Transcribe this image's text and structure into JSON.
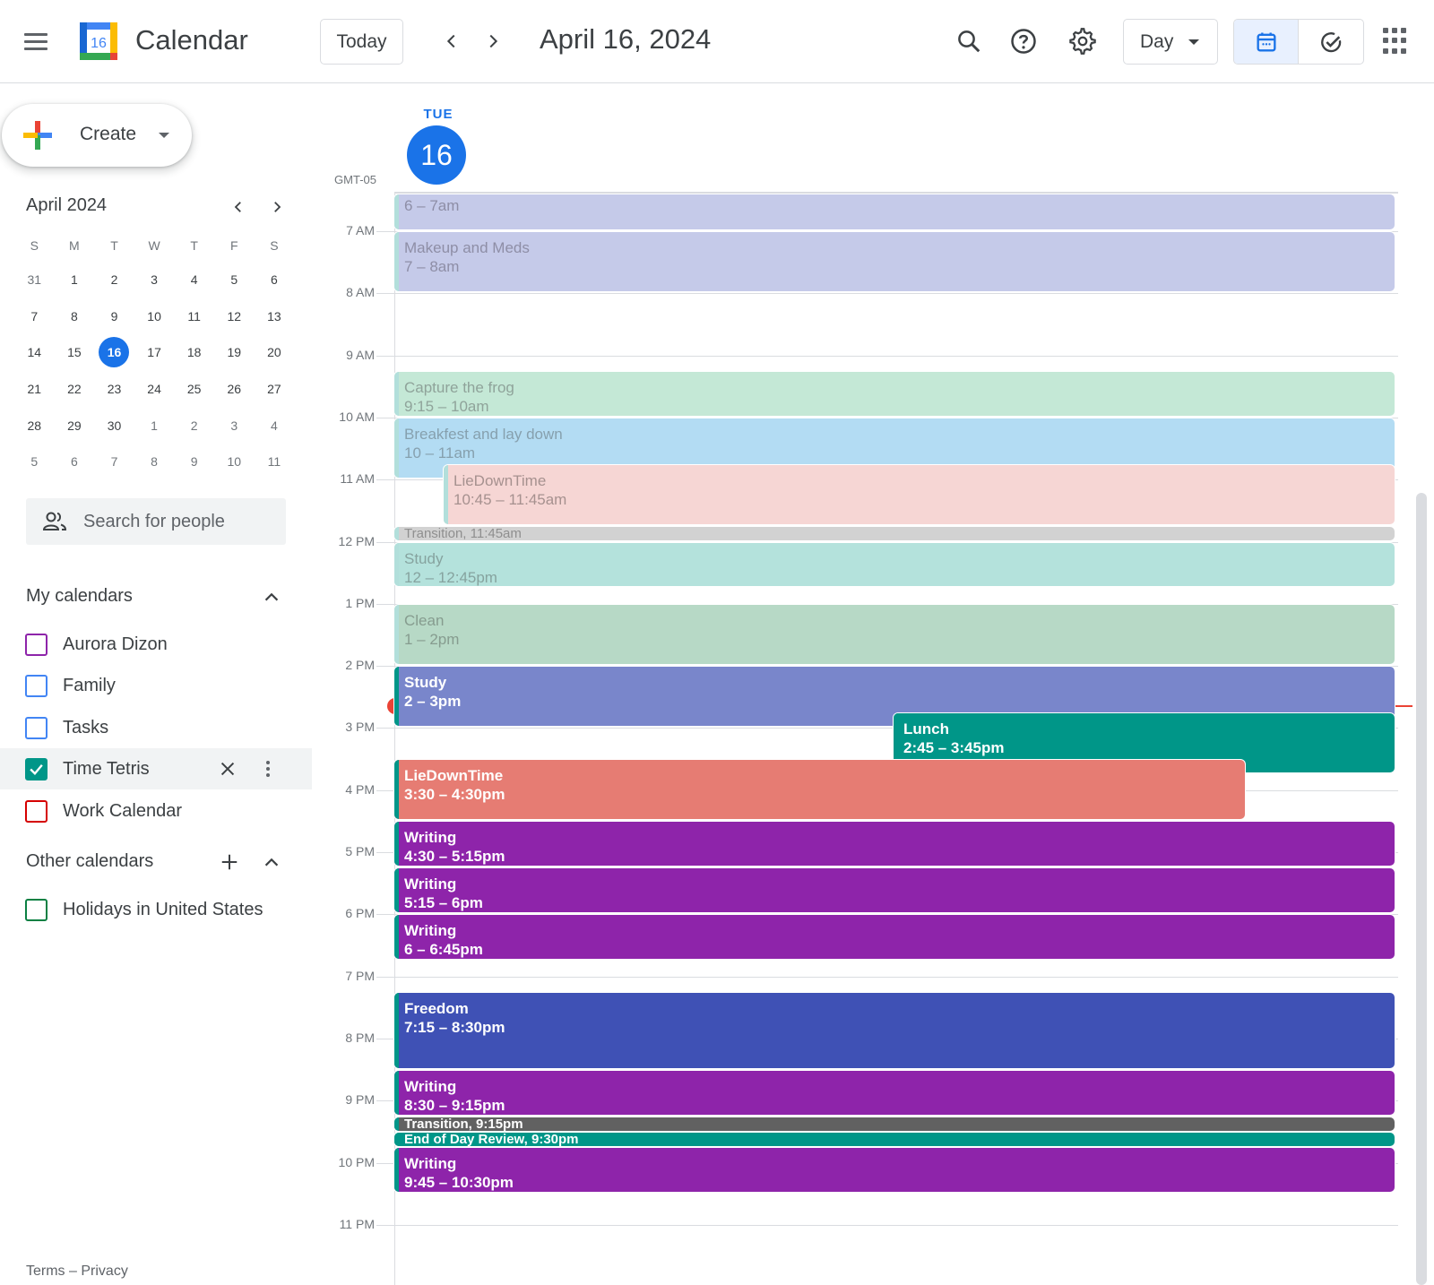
{
  "header": {
    "app_name": "Calendar",
    "logo_day": "16",
    "today_label": "Today",
    "date_title": "April 16, 2024",
    "view_label": "Day"
  },
  "sidebar": {
    "create_label": "Create",
    "mini_calendar": {
      "month_label": "April 2024",
      "weekdays": [
        "S",
        "M",
        "T",
        "W",
        "T",
        "F",
        "S"
      ],
      "weeks": [
        [
          "31",
          "1",
          "2",
          "3",
          "4",
          "5",
          "6"
        ],
        [
          "7",
          "8",
          "9",
          "10",
          "11",
          "12",
          "13"
        ],
        [
          "14",
          "15",
          "16",
          "17",
          "18",
          "19",
          "20"
        ],
        [
          "21",
          "22",
          "23",
          "24",
          "25",
          "26",
          "27"
        ],
        [
          "28",
          "29",
          "30",
          "1",
          "2",
          "3",
          "4"
        ],
        [
          "5",
          "6",
          "7",
          "8",
          "9",
          "10",
          "11"
        ]
      ],
      "selected": "16"
    },
    "search_placeholder": "Search for people",
    "my_calendars_title": "My calendars",
    "my_calendars": [
      {
        "label": "Aurora Dizon",
        "color": "#8e24aa",
        "checked": false
      },
      {
        "label": "Family",
        "color": "#4285f4",
        "checked": false
      },
      {
        "label": "Tasks",
        "color": "#4285f4",
        "checked": false
      },
      {
        "label": "Time Tetris",
        "color": "#009688",
        "checked": true
      },
      {
        "label": "Work Calendar",
        "color": "#d50000",
        "checked": false
      }
    ],
    "other_calendars_title": "Other calendars",
    "other_calendars": [
      {
        "label": "Holidays in United States",
        "color": "#0b8043",
        "checked": false
      }
    ],
    "footer": {
      "terms": "Terms",
      "sep": "–",
      "privacy": "Privacy"
    }
  },
  "day_view": {
    "weekday": "TUE",
    "day_number": "16",
    "timezone": "GMT-05",
    "hours": [
      "7 AM",
      "8 AM",
      "9 AM",
      "10 AM",
      "11 AM",
      "12 PM",
      "1 PM",
      "2 PM",
      "3 PM",
      "4 PM",
      "5 PM",
      "6 PM",
      "7 PM",
      "8 PM",
      "9 PM",
      "10 PM",
      "11 PM"
    ],
    "current_time": "2:40pm",
    "events": [
      {
        "title": "",
        "time": "6 – 7am",
        "color": "#c5cae9",
        "text_color": "#8e8ea6",
        "faded": true
      },
      {
        "title": "Makeup and Meds",
        "time": "7 – 8am",
        "color": "#c5cae9",
        "text_color": "#8e8ea6",
        "faded": true
      },
      {
        "title": "Capture the frog",
        "time": "9:15 – 10am",
        "color": "#c4e8d6",
        "text_color": "#8fa39a",
        "faded": true
      },
      {
        "title": "Breakfest and lay down",
        "time": "10 – 11am",
        "color": "#b3dcf3",
        "text_color": "#86a0ae",
        "faded": true
      },
      {
        "title": "LieDownTime",
        "time": "10:45 – 11:45am",
        "color": "#f6d6d4",
        "text_color": "#a6918f",
        "faded": true
      },
      {
        "title": "Transition, 11:45am",
        "time": "",
        "color": "#d2d2d2",
        "text_color": "#8f8f8f",
        "faded": true
      },
      {
        "title": "Study",
        "time": "12 – 12:45pm",
        "color": "#b4e2dc",
        "text_color": "#86a39f",
        "faded": true
      },
      {
        "title": "Clean",
        "time": "1 – 2pm",
        "color": "#b7d9c6",
        "text_color": "#869c8f",
        "faded": true
      },
      {
        "title": "Study",
        "time": "2 – 3pm",
        "color": "#7986cb",
        "text_color": "#ffffff",
        "faded": false
      },
      {
        "title": "Lunch",
        "time": "2:45 – 3:45pm",
        "color": "#009688",
        "text_color": "#ffffff",
        "faded": false
      },
      {
        "title": "LieDownTime",
        "time": "3:30 – 4:30pm",
        "color": "#e67c73",
        "text_color": "#ffffff",
        "faded": false
      },
      {
        "title": "Writing",
        "time": "4:30 – 5:15pm",
        "color": "#8e24aa",
        "text_color": "#ffffff",
        "faded": false
      },
      {
        "title": "Writing",
        "time": "5:15 – 6pm",
        "color": "#8e24aa",
        "text_color": "#ffffff",
        "faded": false
      },
      {
        "title": "Writing",
        "time": "6 – 6:45pm",
        "color": "#8e24aa",
        "text_color": "#ffffff",
        "faded": false
      },
      {
        "title": "Freedom",
        "time": "7:15 – 8:30pm",
        "color": "#3f51b5",
        "text_color": "#ffffff",
        "faded": false
      },
      {
        "title": "Writing",
        "time": "8:30 – 9:15pm",
        "color": "#8e24aa",
        "text_color": "#ffffff",
        "faded": false
      },
      {
        "title": "Transition, 9:15pm",
        "time": "",
        "color": "#616161",
        "text_color": "#ffffff",
        "faded": false
      },
      {
        "title": "End of Day Review, 9:30pm",
        "time": "",
        "color": "#009688",
        "text_color": "#ffffff",
        "faded": false
      },
      {
        "title": "Writing",
        "time": "9:45 – 10:30pm",
        "color": "#8e24aa",
        "text_color": "#ffffff",
        "faded": false
      }
    ]
  },
  "colors": {
    "accent": "#1a73e8",
    "now_line": "#ea4335",
    "stripe": "#009688"
  },
  "icons": {
    "menu": "hamburger-icon",
    "search": "search-icon",
    "help": "help-icon",
    "settings": "gear-icon",
    "calendar_view": "calendar-icon",
    "tasks_view": "check-circle-icon",
    "apps": "apps-grid-icon"
  }
}
